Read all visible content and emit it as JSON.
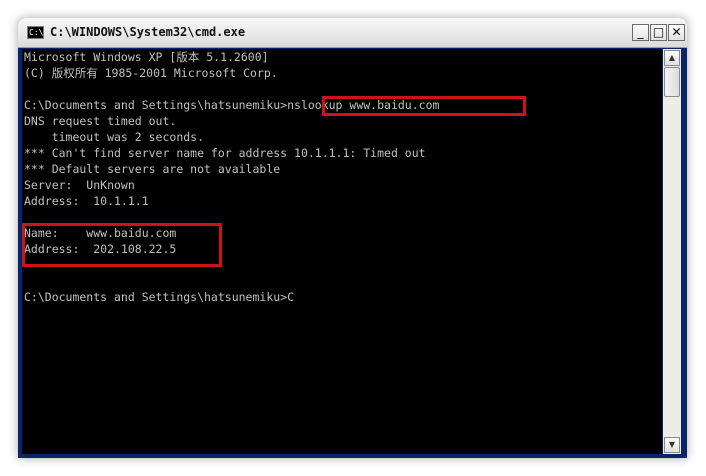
{
  "window": {
    "title": "C:\\WINDOWS\\System32\\cmd.exe",
    "icon_label": "C:\\",
    "buttons": {
      "minimize": "_",
      "maximize": "□",
      "close": "✕"
    }
  },
  "console": {
    "lines": [
      "Microsoft Windows XP [版本 5.1.2600]",
      "(C) 版权所有 1985-2001 Microsoft Corp.",
      "",
      "C:\\Documents and Settings\\hatsunemiku>nslookup www.baidu.com",
      "DNS request timed out.",
      "    timeout was 2 seconds.",
      "*** Can't find server name for address 10.1.1.1: Timed out",
      "*** Default servers are not available",
      "Server:  UnKnown",
      "Address:  10.1.1.1",
      "",
      "Name:    www.baidu.com",
      "Address:  202.108.22.5",
      "",
      "",
      "C:\\Documents and Settings\\hatsunemiku>C"
    ]
  },
  "scrollbar": {
    "up_arrow": "▲",
    "down_arrow": "▼"
  },
  "colors": {
    "console_bg": "#000000",
    "console_text": "#c0c0c0",
    "highlight_border": "#d01217"
  }
}
